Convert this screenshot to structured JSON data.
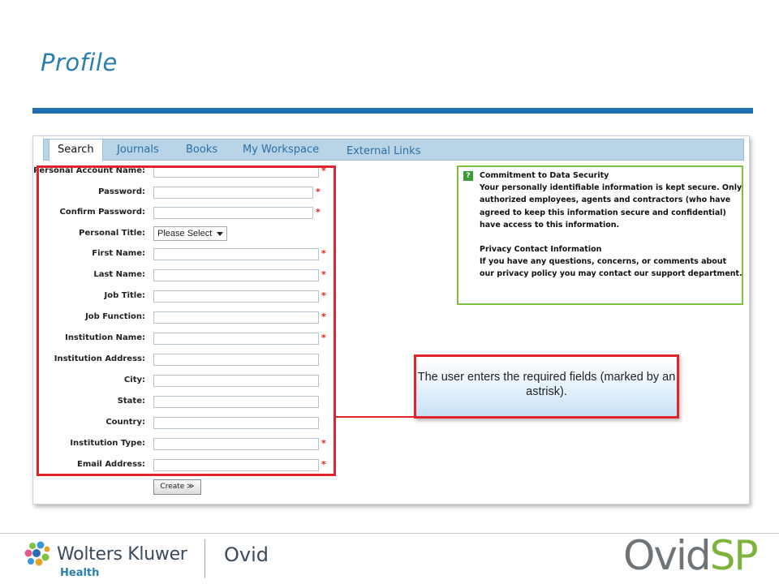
{
  "slide": {
    "title": "Profile"
  },
  "tabs": [
    {
      "label": "Search",
      "active": true
    },
    {
      "label": "Journals",
      "active": false
    },
    {
      "label": "Books",
      "active": false
    },
    {
      "label": "My Workspace",
      "active": false
    },
    {
      "label": "External Links",
      "active": false
    }
  ],
  "form": {
    "fields": [
      {
        "label": "Personal Account Name:",
        "value": "",
        "required": true
      },
      {
        "label": "Password:",
        "value": "",
        "required": true
      },
      {
        "label": "Confirm Password:",
        "value": "",
        "required": true
      },
      {
        "label": "Personal Title:",
        "value": "Please Select",
        "required": false,
        "type": "select"
      },
      {
        "label": "First Name:",
        "value": "",
        "required": true
      },
      {
        "label": "Last Name:",
        "value": "",
        "required": true
      },
      {
        "label": "Job Title:",
        "value": "",
        "required": true
      },
      {
        "label": "Job Function:",
        "value": "",
        "required": true
      },
      {
        "label": "Institution Name:",
        "value": "",
        "required": true
      },
      {
        "label": "Institution Address:",
        "value": "",
        "required": false
      },
      {
        "label": "City:",
        "value": "",
        "required": false
      },
      {
        "label": "State:",
        "value": "",
        "required": false
      },
      {
        "label": "Country:",
        "value": "",
        "required": false
      },
      {
        "label": "Institution Type:",
        "value": "",
        "required": true
      },
      {
        "label": "Email Address:",
        "value": "",
        "required": true
      }
    ],
    "required_marker": "*",
    "create_button": "Create ≫"
  },
  "security": {
    "icon_text": "?",
    "heading": "Commitment to Data Security",
    "body": "Your personally identifiable information is kept secure. Only authorized employees, agents and contractors (who have agreed to keep this information secure and confidential) have access to this information.",
    "privacy_heading": "Privacy Contact Information",
    "privacy_body": "If you have any questions, concerns, or comments about our privacy policy you may contact our support department."
  },
  "callout": {
    "text": "The user enters the required fields (marked by an astrisk)."
  },
  "footer": {
    "brand": "Wolters Kluwer",
    "division": "Health",
    "product": "Ovid",
    "product_logo_a": "Ovid",
    "product_logo_b": "SP"
  },
  "colors": {
    "title_blue": "#2a7fb0",
    "rule_blue": "#1f6fb2",
    "tab_bar": "#b9d4e7",
    "highlight_red": "#e0242c",
    "security_green": "#7ec23b",
    "sp_green": "#7db33a"
  }
}
